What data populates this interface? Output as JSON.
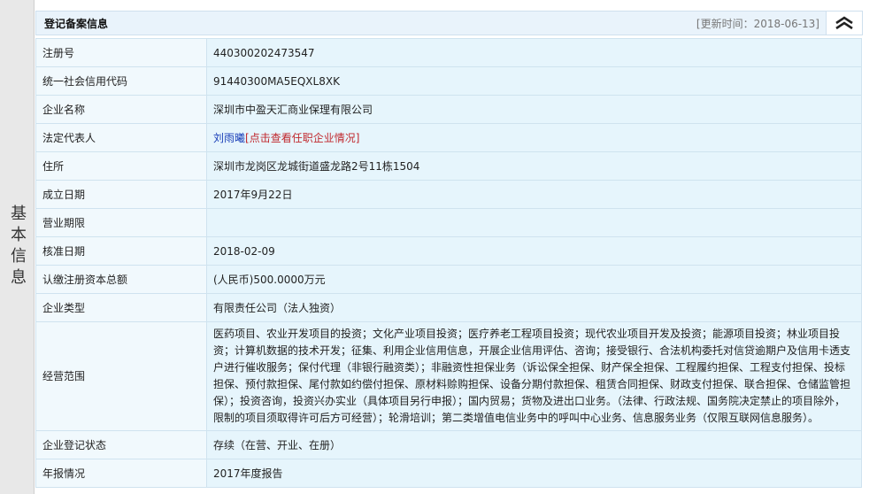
{
  "side_tab": {
    "label": "基本信息"
  },
  "header": {
    "title": "登记备案信息",
    "updated": "[更新时间：2018-06-13]"
  },
  "colors": {
    "label_bg": "#f1f9fd",
    "value_bg": "#e6f5fc",
    "border": "#cfe3ef",
    "link_blue": "#1a3fb8",
    "link_red": "#c0282d"
  },
  "icons": {
    "collapse": "double-chevron-up-icon"
  },
  "rows": [
    {
      "label": "注册号",
      "value": "440300202473547"
    },
    {
      "label": "统一社会信用代码",
      "value": "91440300MA5EQXL8XK"
    },
    {
      "label": "企业名称",
      "value": "深圳市中盈天汇商业保理有限公司"
    },
    {
      "label": "法定代表人",
      "value": "刘雨曦",
      "link": "[点击查看任职企业情况]"
    },
    {
      "label": "住所",
      "value": "深圳市龙岗区龙城街道盛龙路2号11栋1504"
    },
    {
      "label": "成立日期",
      "value": "2017年9月22日"
    },
    {
      "label": "营业期限",
      "value": ""
    },
    {
      "label": "核准日期",
      "value": "2018-02-09"
    },
    {
      "label": "认缴注册资本总额",
      "value": "(人民币)500.0000万元"
    },
    {
      "label": "企业类型",
      "value": "有限责任公司（法人独资）"
    },
    {
      "label": "经营范围",
      "value": "医药项目、农业开发项目的投资；文化产业项目投资；医疗养老工程项目投资；现代农业项目开发及投资；能源项目投资；林业项目投资；计算机数据的技术开发；征集、利用企业信用信息，开展企业信用评估、咨询；接受银行、合法机构委托对信贷逾期户及信用卡透支户进行催收服务；保付代理（非银行融资类）；非融资性担保业务（诉讼保全担保、财产保全担保、工程履约担保、工程支付担保、投标担保、预付款担保、尾付款如约偿付担保、原材料赊购担保、设备分期付款担保、租赁合同担保、财政支付担保、联合担保、仓储监管担保）；投资咨询，投资兴办实业（具体项目另行申报）；国内贸易；货物及进出口业务。（法律、行政法规、国务院决定禁止的项目除外，限制的项目须取得许可后方可经营）；轮滑培训；第二类增值电信业务中的呼叫中心业务、信息服务业务（仅限互联网信息服务）。"
    },
    {
      "label": "企业登记状态",
      "value": "存续（在营、开业、在册）"
    },
    {
      "label": "年报情况",
      "value": "2017年度报告"
    }
  ]
}
